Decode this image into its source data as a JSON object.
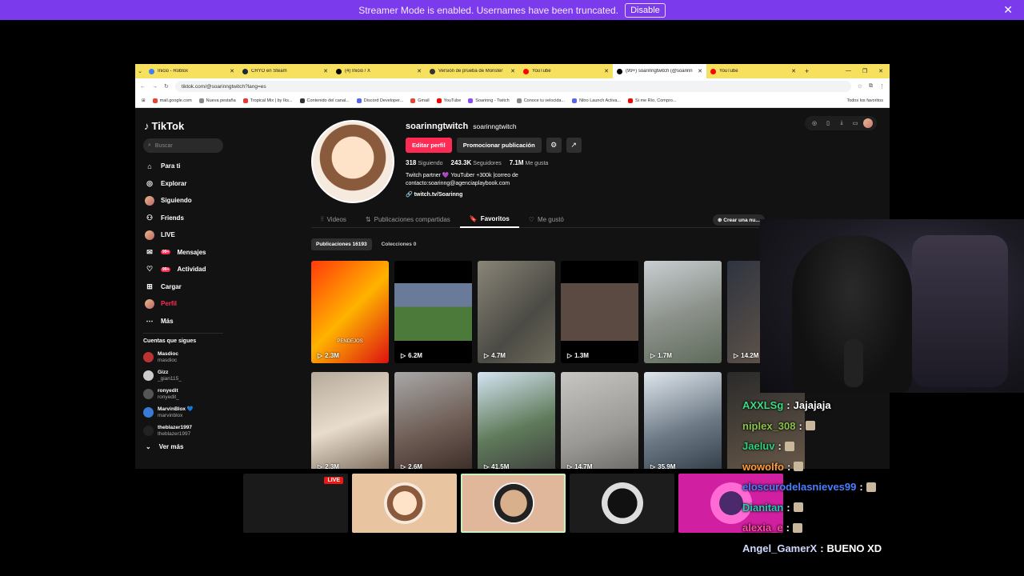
{
  "streamer_bar": {
    "message": "Streamer Mode is enabled. Usernames have been truncated.",
    "disable_label": "Disable"
  },
  "browser": {
    "tabs": [
      {
        "label": "Inicio - Roblox",
        "color": "#3b82f6"
      },
      {
        "label": "CRYO en Steam",
        "color": "#1b2838"
      },
      {
        "label": "(4) Inicio / X",
        "color": "#000000"
      },
      {
        "label": "Versión de prueba de Monster",
        "color": "#333333"
      },
      {
        "label": "YouTube",
        "color": "#ff0000"
      },
      {
        "label": "(99+) soarinngtwitch (@soarinn",
        "color": "#000000"
      },
      {
        "label": "YouTube",
        "color": "#ff0000"
      }
    ],
    "url": "tiktok.com/@soarinngtwitch?lang=es",
    "bookmarks": [
      "mail.google.com",
      "Nueva pestaña",
      "Tropical Mix | by Iks...",
      "Contenido del canal...",
      "Discord Developer...",
      "Gmail",
      "YouTube",
      "Soarinng - Twitch",
      "Conoce tu velocida...",
      "Nitro Launch Activa...",
      "Si me Río, Compro..."
    ],
    "bookmarks_all": "Todos los favoritos"
  },
  "tiktok": {
    "logo": "TikTok",
    "search_placeholder": "Buscar",
    "nav": [
      {
        "label": "Para ti",
        "icon": "home-icon"
      },
      {
        "label": "Explorar",
        "icon": "compass-icon"
      },
      {
        "label": "Siguiendo",
        "icon": "following-icon"
      },
      {
        "label": "Friends",
        "icon": "friends-icon"
      },
      {
        "label": "LIVE",
        "icon": "live-icon"
      },
      {
        "label": "Mensajes",
        "icon": "messages-icon",
        "badge": "99+"
      },
      {
        "label": "Actividad",
        "icon": "activity-icon",
        "badge": "99+"
      },
      {
        "label": "Cargar",
        "icon": "upload-icon"
      },
      {
        "label": "Perfil",
        "icon": "profile-icon"
      },
      {
        "label": "Más",
        "icon": "more-icon"
      }
    ],
    "following_title": "Cuentas que sigues",
    "following": [
      {
        "name": "Masdioc",
        "handle": "masdioc"
      },
      {
        "name": "Gizz",
        "handle": "_gian115_"
      },
      {
        "name": "ronyedit",
        "handle": "ronyedit_"
      },
      {
        "name": "MarvinBlox 💙",
        "handle": "marvinblox"
      },
      {
        "name": "theblazer1997",
        "handle": "theblazer1997"
      }
    ],
    "see_more": "Ver más",
    "profile": {
      "display_name": "soarinngtwitch",
      "username": "soarinngtwitch",
      "edit_button": "Editar perfil",
      "promo_button": "Promocionar publicación",
      "following_count": "318",
      "following_label": "Siguiendo",
      "followers_count": "243.3K",
      "followers_label": "Seguidores",
      "likes_count": "7.1M",
      "likes_label": "Me gusta",
      "bio": "Twitch partner 💜 YouTuber +300k |correo de contacto:soarinng@agenciaplaybook.com",
      "link": "twitch.tv/Soarinng"
    },
    "tabs": [
      "Videos",
      "Publicaciones compartidas",
      "Favoritos",
      "Me gustó"
    ],
    "active_tab": "Favoritos",
    "create_button": "Crear una nu...",
    "subtabs": [
      "Publicaciones 16193",
      "Colecciones 0"
    ],
    "videos": [
      {
        "views": "2.3M",
        "caption": "PENDEJOS",
        "bg": "linear-gradient(135deg,#ff3b0a,#ffb300 50%,#d11)"
      },
      {
        "views": "6.2M",
        "caption": "",
        "bg": "linear-gradient(#000 0 22%,#6a7b9a 22% 45%,#4c7a3a 45% 78%,#000 78%)"
      },
      {
        "views": "4.7M",
        "caption": "",
        "bg": "linear-gradient(135deg,#8a8578,#4b4a44 60%,#6e6a5c)"
      },
      {
        "views": "1.3M",
        "caption": "",
        "bg": "linear-gradient(#000 0 22%,#5b4a42 22% 78%,#000 78%)"
      },
      {
        "views": "1.7M",
        "caption": "",
        "bg": "linear-gradient(160deg,#c9cfd2,#8d938c 50%,#5f6a5b)"
      },
      {
        "views": "14.2M",
        "caption": "",
        "bg": "linear-gradient(135deg,#2e3440,#6c5b4b)"
      },
      {
        "views": "2.3M",
        "caption": "",
        "bg": "linear-gradient(160deg,#b6aa9a,#e8dccd 50%,#7a6a5a)"
      },
      {
        "views": "2.6M",
        "caption": "",
        "bg": "linear-gradient(160deg,#a8a8a8,#6e5d55 55%,#3a2a25)"
      },
      {
        "views": "41.5M",
        "caption": "",
        "bg": "linear-gradient(160deg,#d4e4f2,#5f7a5a 55%,#3e3e3e)"
      },
      {
        "views": "14.7M",
        "caption": "",
        "bg": "linear-gradient(160deg,#c8c6c2,#9a9894 60%,#6a6864)"
      },
      {
        "views": "35.9M",
        "caption": "",
        "bg": "linear-gradient(160deg,#dfe6ec,#6d7a86 55%,#2f3a44)"
      },
      {
        "views": "",
        "caption": "",
        "bg": "linear-gradient(160deg,#2a2a2a,#6a5a4a)"
      }
    ]
  },
  "stream": {
    "participants": [
      {
        "bg": "#1a1a1a",
        "live": "LIVE"
      },
      {
        "bg": "#e9c4a0",
        "live": ""
      },
      {
        "bg": "#e0b79a",
        "live": ""
      },
      {
        "bg": "#1c1c1c",
        "live": ""
      },
      {
        "bg": "#d01fa0",
        "live": ""
      }
    ],
    "chat": [
      {
        "user": "AXXLSg",
        "color": "#3ddc84",
        "text": "Jajajaja"
      },
      {
        "user": "niplex_308",
        "color": "#8bc34a",
        "text": ""
      },
      {
        "user": "Jaeluv",
        "color": "#2fd17a",
        "text": ""
      },
      {
        "user": "wowolfo",
        "color": "#ff9a3c",
        "text": ""
      },
      {
        "user": "eloscurodelasnieves99",
        "color": "#4a7fff",
        "text": ""
      },
      {
        "user": "Dianitan",
        "color": "#1fd1b3",
        "text": ""
      },
      {
        "user": "alexia_e",
        "color": "#ff4fa3",
        "text": ""
      },
      {
        "user": "Angel_GamerX",
        "color": "#cfd8ff",
        "text": "BUENO XD"
      }
    ]
  }
}
